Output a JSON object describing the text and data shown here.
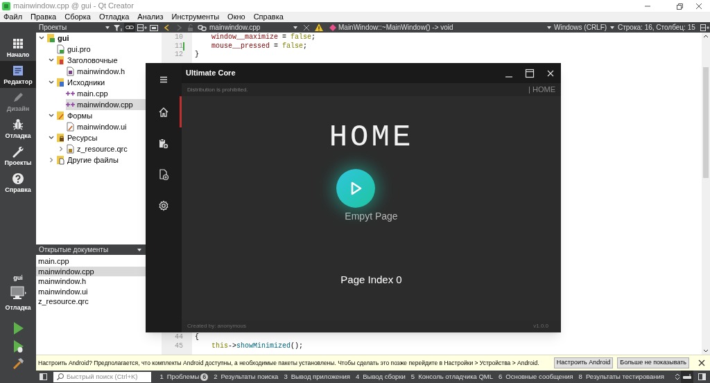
{
  "window": {
    "title": "mainwindow.cpp @ gui - Qt Creator"
  },
  "menu": [
    "Файл",
    "Правка",
    "Сборка",
    "Отладка",
    "Анализ",
    "Инструменты",
    "Окно",
    "Справка"
  ],
  "mode_bar": {
    "items": [
      {
        "label": "Начало",
        "kind": "welcome",
        "selected": false,
        "disabled": false
      },
      {
        "label": "Редактор",
        "kind": "edit",
        "selected": true,
        "disabled": false
      },
      {
        "label": "Дизайн",
        "kind": "design",
        "selected": false,
        "disabled": true
      },
      {
        "label": "Отладка",
        "kind": "debug",
        "selected": false,
        "disabled": false
      },
      {
        "label": "Проекты",
        "kind": "projects",
        "selected": false,
        "disabled": false
      },
      {
        "label": "Справка",
        "kind": "help",
        "selected": false,
        "disabled": false
      }
    ],
    "kit": {
      "project": "gui",
      "mode": "Отладка"
    }
  },
  "projects": {
    "title": "Проекты",
    "tree": [
      {
        "label": "gui",
        "kind": "project",
        "expanded": true,
        "selected": false,
        "children": [
          {
            "label": "gui.pro",
            "kind": "pro",
            "selected": false
          },
          {
            "label": "Заголовочные",
            "kind": "headers",
            "expanded": true,
            "selected": false,
            "children": [
              {
                "label": "mainwindow.h",
                "kind": "header",
                "selected": false
              }
            ]
          },
          {
            "label": "Исходники",
            "kind": "sources",
            "expanded": true,
            "selected": false,
            "children": [
              {
                "label": "main.cpp",
                "kind": "source",
                "selected": false
              },
              {
                "label": "mainwindow.cpp",
                "kind": "source",
                "selected": true
              }
            ]
          },
          {
            "label": "Формы",
            "kind": "forms",
            "expanded": true,
            "selected": false,
            "children": [
              {
                "label": "mainwindow.ui",
                "kind": "form",
                "selected": false
              }
            ]
          },
          {
            "label": "Ресурсы",
            "kind": "resources",
            "expanded": true,
            "selected": false,
            "children": [
              {
                "label": "z_resource.qrc",
                "kind": "resource",
                "expanded": false,
                "selected": false
              }
            ]
          },
          {
            "label": "Другие файлы",
            "kind": "other",
            "expanded": false,
            "selected": false
          }
        ]
      }
    ]
  },
  "open_documents": {
    "title": "Открытые документы",
    "items": [
      {
        "label": "main.cpp",
        "selected": false
      },
      {
        "label": "mainwindow.cpp",
        "selected": true
      },
      {
        "label": "mainwindow.h",
        "selected": false
      },
      {
        "label": "mainwindow.ui",
        "selected": false
      },
      {
        "label": "z_resource.qrc",
        "selected": false
      }
    ]
  },
  "editor": {
    "file": "mainwindow.cpp",
    "symbol": "MainWindow::~MainWindow() -> void",
    "line_endings": "Windows (CRLF)",
    "position": "Строка: 16, Столбец: 15",
    "lines_top": [
      {
        "number": "10",
        "changed": false,
        "indented": true,
        "tokens": [
          {
            "text": "window__maximize",
            "kind": "member"
          },
          {
            "text": " = ",
            "kind": "plain"
          },
          {
            "text": "false",
            "kind": "keyword"
          },
          {
            "text": ";",
            "kind": "plain"
          }
        ]
      },
      {
        "number": "11",
        "changed": true,
        "indented": true,
        "tokens": [
          {
            "text": "mouse__pressed",
            "kind": "member"
          },
          {
            "text": " = ",
            "kind": "plain"
          },
          {
            "text": "false",
            "kind": "keyword"
          },
          {
            "text": ";",
            "kind": "plain"
          }
        ]
      },
      {
        "number": "12",
        "changed": false,
        "indented": false,
        "tokens": [
          {
            "text": "}",
            "kind": "plain"
          }
        ]
      }
    ],
    "lines_bottom": [
      {
        "number": "44",
        "changed": false,
        "indented": false,
        "tokens": [
          {
            "text": "{",
            "kind": "plain"
          }
        ]
      },
      {
        "number": "45",
        "changed": false,
        "indented": true,
        "tokens": [
          {
            "text": "this",
            "kind": "keyword"
          },
          {
            "text": "->",
            "kind": "plain"
          },
          {
            "text": "showMinimized",
            "kind": "func"
          },
          {
            "text": "();",
            "kind": "plain"
          }
        ]
      }
    ]
  },
  "app_window": {
    "title": "Ultimate Core",
    "notice": "Distribution is prohibited.",
    "breadcrumb": "| HOME",
    "nav": [
      {
        "kind": "home",
        "selected": true
      },
      {
        "kind": "clipboard",
        "selected": false
      },
      {
        "kind": "file-add",
        "selected": false
      },
      {
        "kind": "settings",
        "selected": false
      }
    ],
    "page_title": "HOME",
    "page_label": "Empyt Page",
    "page_index": "Page Index 0",
    "footer_left": "Created by: anonymous",
    "footer_right": "v1.0.0"
  },
  "info_bar": {
    "text": "Настроить Android? Предполагается, что комплекты Android доступны, а необходимые пакеты установлены. Чтобы сделать это позже перейдите в Настройки > Устройства > Android.",
    "buttons": [
      "Настроить Android",
      "Больше не показывать"
    ]
  },
  "status_bar": {
    "search_placeholder": "Быстрый поиск (Ctrl+K)",
    "panes": [
      {
        "number": "1",
        "label": "Проблемы",
        "badge": "6"
      },
      {
        "number": "2",
        "label": "Результаты поиска"
      },
      {
        "number": "3",
        "label": "Вывод приложения"
      },
      {
        "number": "4",
        "label": "Вывод сборки"
      },
      {
        "number": "5",
        "label": "Консоль отладчика QML"
      },
      {
        "number": "6",
        "label": "Основные сообщения"
      },
      {
        "number": "8",
        "label": "Результаты тестирования"
      }
    ]
  }
}
